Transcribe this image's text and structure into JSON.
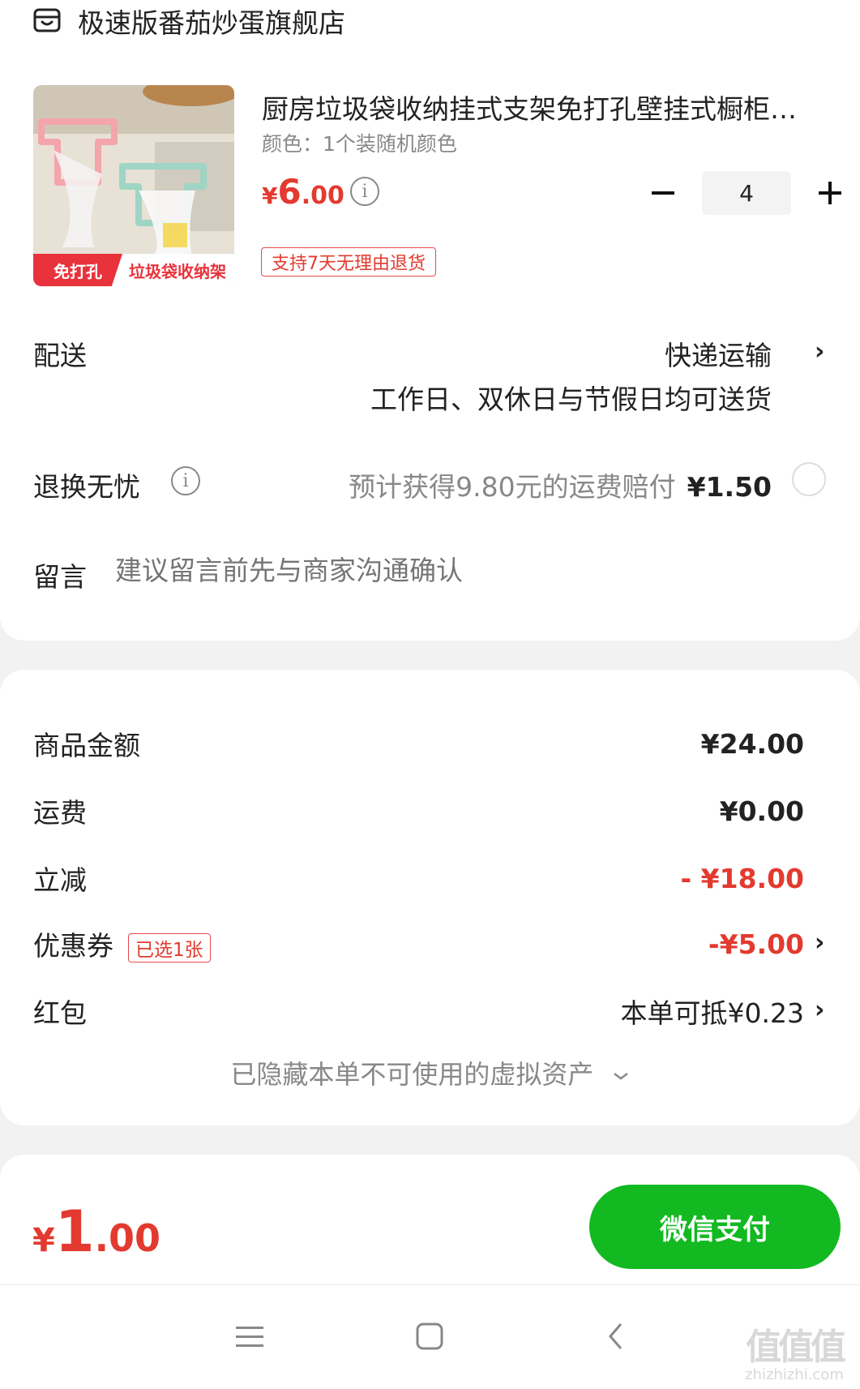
{
  "store": {
    "name": "极速版番茄炒蛋旗舰店",
    "icon": "store-icon"
  },
  "product": {
    "title": "厨房垃圾袋收纳挂式支架免打孔壁挂式橱柜门背垃圾架",
    "spec": "颜色：1个装随机颜色",
    "price": {
      "currency": "¥",
      "integer": "6",
      "decimal": ".00"
    },
    "quantity": "4",
    "return_badge": "支持7天无理由退货",
    "image_tag_left": "免打孔",
    "image_tag_right": "垃圾袋收纳架"
  },
  "shipping": {
    "label": "配送",
    "method": "快递运输",
    "desc": "工作日、双休日与节假日均可送货"
  },
  "return_insurance": {
    "label": "退换无忧",
    "text": "预计获得9.80元的运费赔付",
    "price": "¥1.50"
  },
  "message": {
    "label": "留言",
    "placeholder": "建议留言前先与商家沟通确认"
  },
  "summary": {
    "goods_label": "商品金额",
    "goods_value": "¥24.00",
    "freight_label": "运费",
    "freight_value": "¥0.00",
    "discount_label": "立减",
    "discount_value": "- ¥18.00",
    "coupon_label": "优惠券",
    "coupon_tag": "已选1张",
    "coupon_value": "-¥5.00",
    "redpacket_label": "红包",
    "redpacket_value": "本单可抵¥0.23",
    "hidden_assets": "已隐藏本单不可使用的虚拟资产"
  },
  "pay": {
    "currency": "¥",
    "integer": "1",
    "decimal": ".00",
    "button": "微信支付"
  },
  "watermark": {
    "big": "值值值",
    "small": "zhizhizhi.com"
  },
  "colors": {
    "accent_red": "#e33a2f",
    "pay_green": "#12b921"
  }
}
